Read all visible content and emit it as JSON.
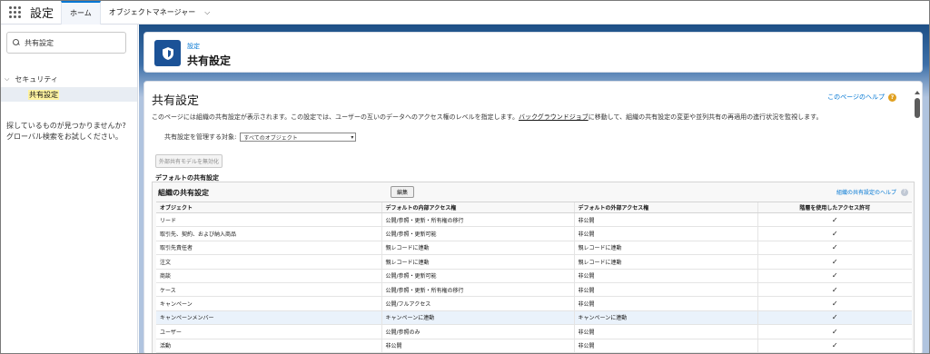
{
  "app": {
    "name": "設定"
  },
  "tabs": [
    {
      "label": "ホーム"
    },
    {
      "label": "オブジェクトマネージャー"
    }
  ],
  "sidebar": {
    "search_value": "共有設定",
    "section_label": "セキュリティ",
    "active_item": "共有設定",
    "not_found_line1": "探しているものが見つかりませんか?",
    "not_found_line2": "グローバル検索をお試しください。"
  },
  "header": {
    "breadcrumb": "設定",
    "title": "共有設定"
  },
  "page": {
    "title": "共有設定",
    "help_link": "このページのヘルプ",
    "desc_part1": "このページには組織の共有設定が表示されます。この設定では、ユーザーの互いのデータへのアクセス権のレベルを指定します。",
    "desc_link": "バックグラウンドジョブ",
    "desc_part2": "に移動して、組織の共有設定の変更や並列共有の再適用の進行状況を監視します。",
    "manage_label": "共有設定を管理する対象:",
    "manage_select": "すべてのオブジェクト",
    "disable_button": "外部共有モデルを無効化",
    "default_heading": "デフォルトの共有設定"
  },
  "org_table": {
    "title": "組織の共有設定",
    "edit_button": "編集",
    "help_link": "組織の共有設定のヘルプ",
    "columns": [
      "オブジェクト",
      "デフォルトの内部アクセス権",
      "デフォルトの外部アクセス権",
      "階層を使用したアクセス許可"
    ],
    "rows": [
      {
        "object": "リード",
        "internal": "公開/参照・更新・所有権の移行",
        "external": "非公開",
        "hierarchy": "✓"
      },
      {
        "object": "取引先、契約、および納入商品",
        "internal": "公開/参照・更新可能",
        "external": "非公開",
        "hierarchy": "✓"
      },
      {
        "object": "取引先責任者",
        "internal": "親レコードに連動",
        "external": "親レコードに連動",
        "hierarchy": "✓"
      },
      {
        "object": "注文",
        "internal": "親レコードに連動",
        "external": "親レコードに連動",
        "hierarchy": "✓"
      },
      {
        "object": "商談",
        "internal": "公開/参照・更新可能",
        "external": "非公開",
        "hierarchy": "✓"
      },
      {
        "object": "ケース",
        "internal": "公開/参照・更新・所有権の移行",
        "external": "非公開",
        "hierarchy": "✓"
      },
      {
        "object": "キャンペーン",
        "internal": "公開/フルアクセス",
        "external": "非公開",
        "hierarchy": "✓"
      },
      {
        "object": "キャンペーンメンバー",
        "internal": "キャンペーンに連動",
        "external": "キャンペーンに連動",
        "hierarchy": "✓"
      },
      {
        "object": "ユーザー",
        "internal": "公開/参照のみ",
        "external": "非公開",
        "hierarchy": "✓"
      },
      {
        "object": "活動",
        "internal": "非公開",
        "external": "非公開",
        "hierarchy": "✓"
      }
    ]
  }
}
